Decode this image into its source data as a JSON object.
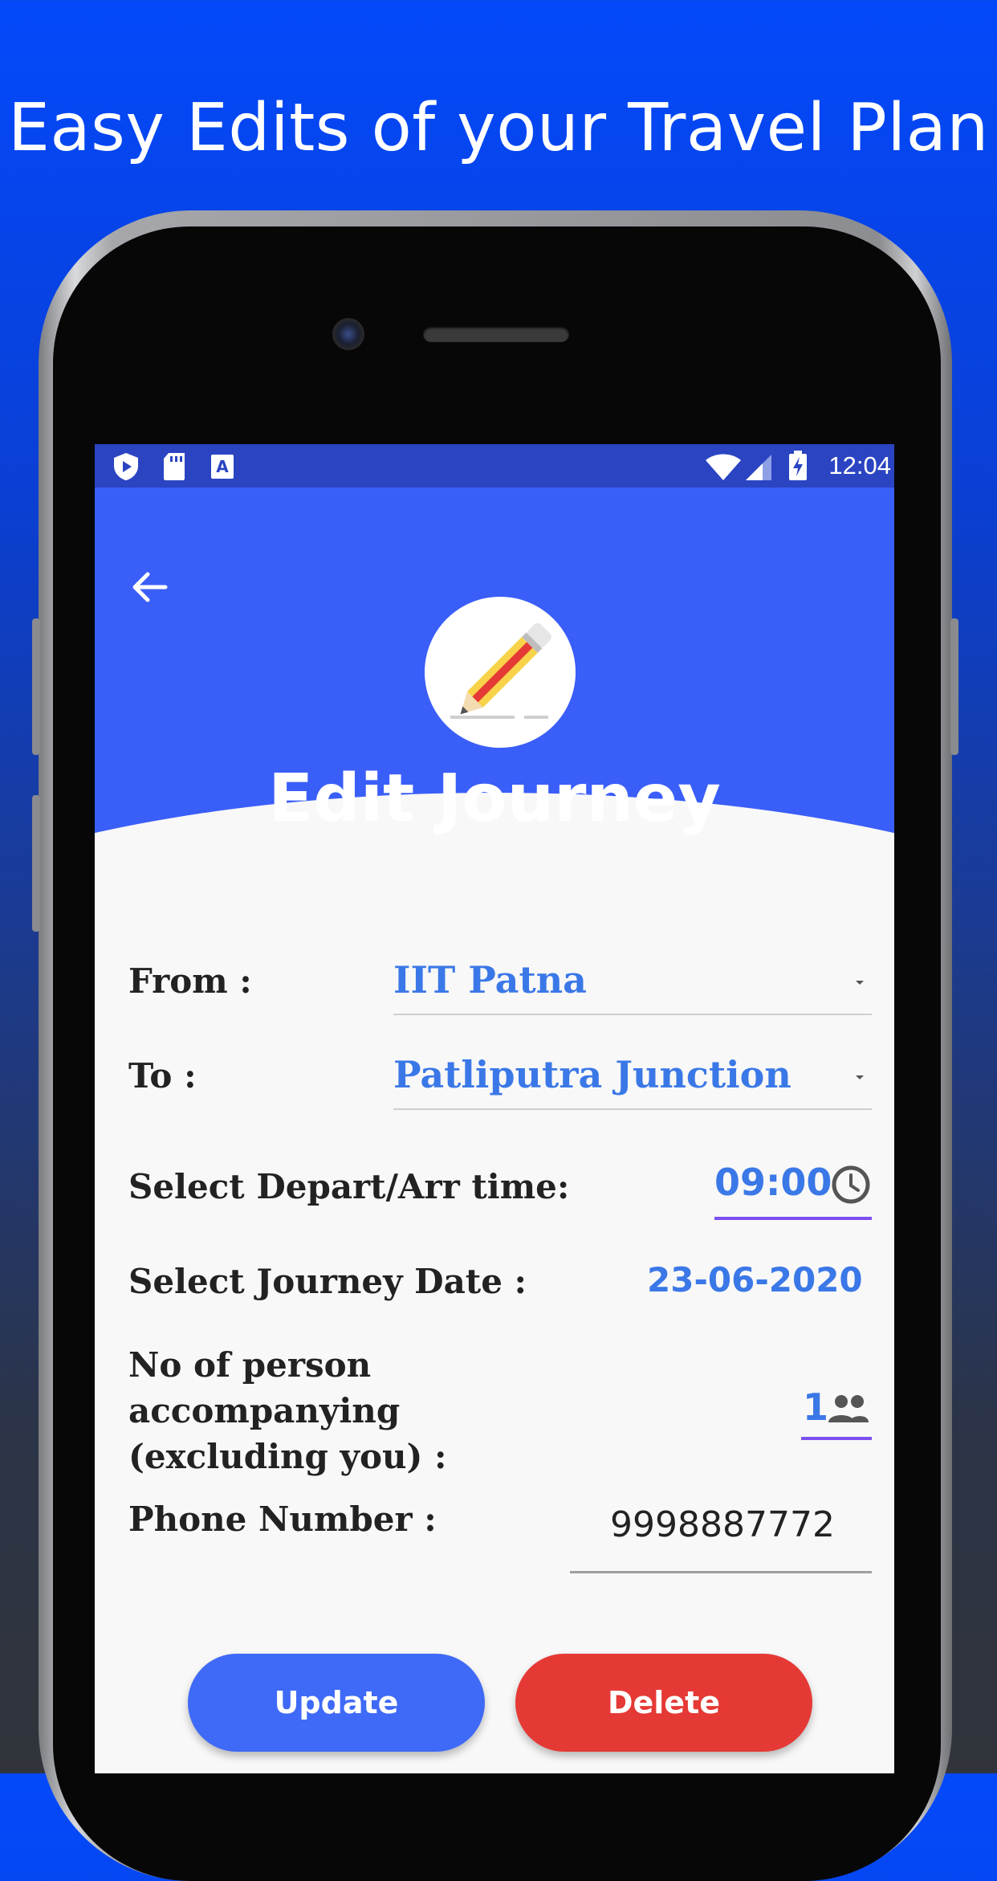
{
  "promo": {
    "title": "Easy Edits of your Travel Plan"
  },
  "status_bar": {
    "time": "12:04",
    "left_icons": [
      "shield-play-icon",
      "sd-card-icon",
      "text-a-icon"
    ],
    "right_icons": [
      "wifi-icon",
      "signal-icon",
      "battery-charging-icon"
    ]
  },
  "header": {
    "title": "Edit Journey",
    "back_icon": "arrow-left-icon",
    "hero_icon": "pencil-icon"
  },
  "form": {
    "from_label": "From :",
    "from_value": "IIT Patna",
    "to_label": "To :",
    "to_value": "Patliputra Junction",
    "time_label": "Select Depart/Arr time:",
    "time_value": "09:00",
    "date_label": "Select Journey Date :",
    "date_value": "23-06-2020",
    "persons_label_line1": "No of person",
    "persons_label_line2": "accompanying",
    "persons_label_line3": "(excluding you) :",
    "persons_value": "1",
    "phone_label": "Phone Number :",
    "phone_value": "9998887772"
  },
  "actions": {
    "update_label": "Update",
    "delete_label": "Delete"
  },
  "colors": {
    "primary": "#3a5ef8",
    "accent_blue": "#3b78e7",
    "delete_red": "#e53935",
    "update_blue": "#3f6af7",
    "underline_purple": "#7b4ff0"
  }
}
